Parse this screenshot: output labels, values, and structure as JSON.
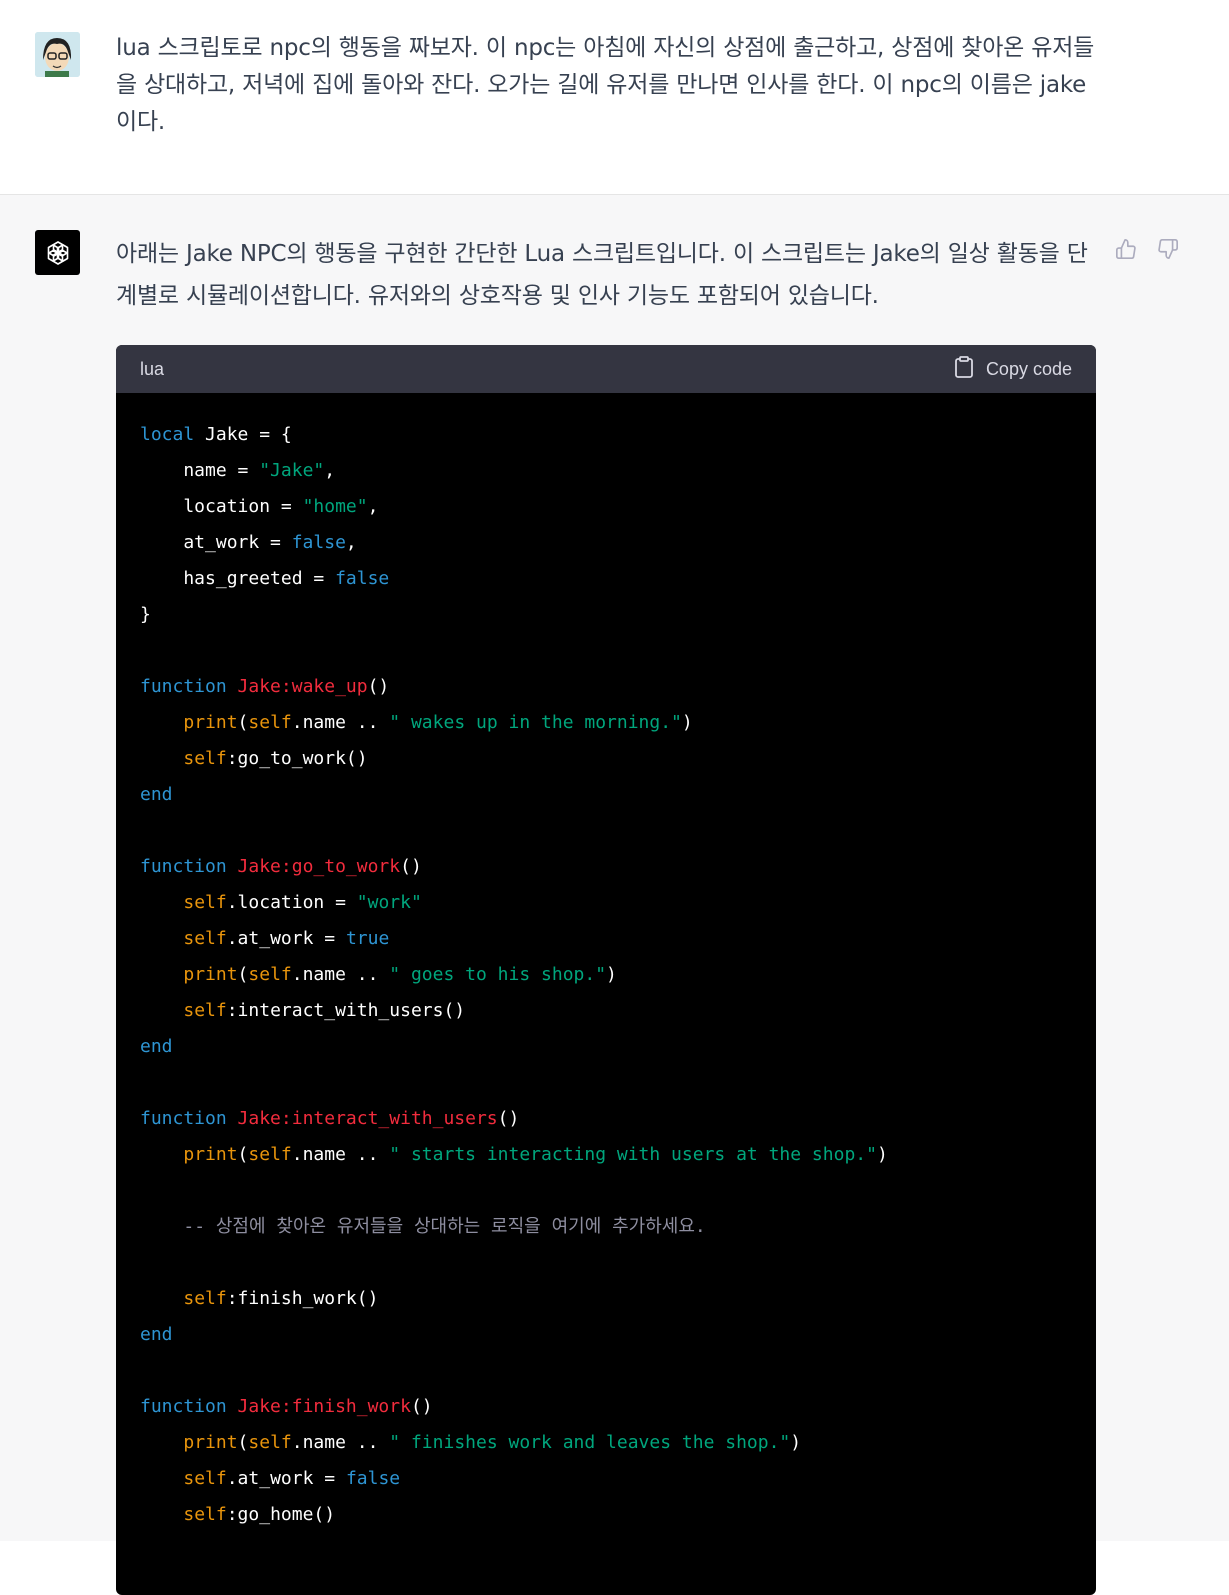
{
  "user_message": {
    "text": "lua 스크립토로 npc의 행동을 짜보자. 이 npc는 아침에 자신의 상점에 출근하고, 상점에 찾아온 유저들을 상대하고, 저녁에 집에 돌아와 잔다. 오가는 길에 유저를 만나면 인사를 한다. 이 npc의 이름은 jake이다."
  },
  "assistant_message": {
    "intro": "아래는 Jake NPC의 행동을 구현한 간단한 Lua 스크립트입니다. 이 스크립트는 Jake의 일상 활동을 단계별로 시뮬레이션합니다. 유저와의 상호작용 및 인사 기능도 포함되어 있습니다.",
    "feedback": {
      "thumbs_up_icon": "thumbs-up-icon",
      "thumbs_down_icon": "thumbs-down-icon"
    }
  },
  "code_block": {
    "language": "lua",
    "copy_label": "Copy code",
    "lines": [
      [
        [
          "kw",
          "local"
        ],
        [
          "plain",
          " Jake = {"
        ]
      ],
      [
        [
          "plain",
          "    name = "
        ],
        [
          "str",
          "\"Jake\""
        ],
        [
          "plain",
          ","
        ]
      ],
      [
        [
          "plain",
          "    location = "
        ],
        [
          "str",
          "\"home\""
        ],
        [
          "plain",
          ","
        ]
      ],
      [
        [
          "plain",
          "    at_work = "
        ],
        [
          "kw",
          "false"
        ],
        [
          "plain",
          ","
        ]
      ],
      [
        [
          "plain",
          "    has_greeted = "
        ],
        [
          "kw",
          "false"
        ]
      ],
      [
        [
          "plain",
          "}"
        ]
      ],
      [],
      [
        [
          "kw",
          "function"
        ],
        [
          "plain",
          " "
        ],
        [
          "fn",
          "Jake:wake_up"
        ],
        [
          "plain",
          "()"
        ]
      ],
      [
        [
          "plain",
          "    "
        ],
        [
          "builtin",
          "print"
        ],
        [
          "plain",
          "("
        ],
        [
          "builtin",
          "self"
        ],
        [
          "plain",
          ".name .. "
        ],
        [
          "str",
          "\" wakes up in the morning.\""
        ],
        [
          "plain",
          ")"
        ]
      ],
      [
        [
          "plain",
          "    "
        ],
        [
          "builtin",
          "self"
        ],
        [
          "plain",
          ":go_to_work()"
        ]
      ],
      [
        [
          "kw",
          "end"
        ]
      ],
      [],
      [
        [
          "kw",
          "function"
        ],
        [
          "plain",
          " "
        ],
        [
          "fn",
          "Jake:go_to_work"
        ],
        [
          "plain",
          "()"
        ]
      ],
      [
        [
          "plain",
          "    "
        ],
        [
          "builtin",
          "self"
        ],
        [
          "plain",
          ".location = "
        ],
        [
          "str",
          "\"work\""
        ]
      ],
      [
        [
          "plain",
          "    "
        ],
        [
          "builtin",
          "self"
        ],
        [
          "plain",
          ".at_work = "
        ],
        [
          "kw",
          "true"
        ]
      ],
      [
        [
          "plain",
          "    "
        ],
        [
          "builtin",
          "print"
        ],
        [
          "plain",
          "("
        ],
        [
          "builtin",
          "self"
        ],
        [
          "plain",
          ".name .. "
        ],
        [
          "str",
          "\" goes to his shop.\""
        ],
        [
          "plain",
          ")"
        ]
      ],
      [
        [
          "plain",
          "    "
        ],
        [
          "builtin",
          "self"
        ],
        [
          "plain",
          ":interact_with_users()"
        ]
      ],
      [
        [
          "kw",
          "end"
        ]
      ],
      [],
      [
        [
          "kw",
          "function"
        ],
        [
          "plain",
          " "
        ],
        [
          "fn",
          "Jake:interact_with_users"
        ],
        [
          "plain",
          "()"
        ]
      ],
      [
        [
          "plain",
          "    "
        ],
        [
          "builtin",
          "print"
        ],
        [
          "plain",
          "("
        ],
        [
          "builtin",
          "self"
        ],
        [
          "plain",
          ".name .. "
        ],
        [
          "str",
          "\" starts interacting with users at the shop.\""
        ],
        [
          "plain",
          ")"
        ]
      ],
      [],
      [
        [
          "plain",
          "    "
        ],
        [
          "cmt",
          "-- 상점에 찾아온 유저들을 상대하는 로직을 여기에 추가하세요."
        ]
      ],
      [],
      [
        [
          "plain",
          "    "
        ],
        [
          "builtin",
          "self"
        ],
        [
          "plain",
          ":finish_work()"
        ]
      ],
      [
        [
          "kw",
          "end"
        ]
      ],
      [],
      [
        [
          "kw",
          "function"
        ],
        [
          "plain",
          " "
        ],
        [
          "fn",
          "Jake:finish_work"
        ],
        [
          "plain",
          "()"
        ]
      ],
      [
        [
          "plain",
          "    "
        ],
        [
          "builtin",
          "print"
        ],
        [
          "plain",
          "("
        ],
        [
          "builtin",
          "self"
        ],
        [
          "plain",
          ".name .. "
        ],
        [
          "str",
          "\" finishes work and leaves the shop.\""
        ],
        [
          "plain",
          ")"
        ]
      ],
      [
        [
          "plain",
          "    "
        ],
        [
          "builtin",
          "self"
        ],
        [
          "plain",
          ".at_work = "
        ],
        [
          "kw",
          "false"
        ]
      ],
      [
        [
          "plain",
          "    "
        ],
        [
          "builtin",
          "self"
        ],
        [
          "plain",
          ":go_home()"
        ]
      ]
    ]
  },
  "colors": {
    "code_bg": "#000000",
    "code_header_bg": "#343541",
    "keyword": "#2e95d3",
    "string": "#00a67d",
    "function_name": "#f22c3d",
    "builtin": "#e9950c",
    "comment": "#8e8ea0"
  },
  "icons": {
    "user_avatar": "user-avatar",
    "assistant_avatar": "openai-logo-icon",
    "copy": "clipboard-icon"
  }
}
